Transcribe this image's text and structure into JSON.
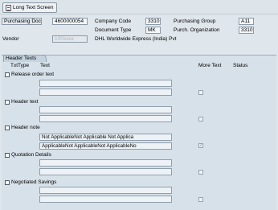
{
  "toolbar": {
    "long_text_label": "Long Text Screen"
  },
  "header": {
    "purchasing_doc_label": "Purchasing Doc.",
    "purchasing_doc_value": "4600000054",
    "company_code_label": "Company Code",
    "company_code_value": "3310",
    "purchasing_group_label": "Purchasing Group",
    "purchasing_group_value": "A11",
    "document_type_label": "Document Type",
    "document_type_value": "MK",
    "purch_org_label": "Purch. Organization",
    "purch_org_value": "3310",
    "vendor_label": "Vendor",
    "vendor_value": "100xxxx",
    "vendor_name": "DHL Worldwide Express (India) Pvt"
  },
  "panel": {
    "tab_label": "Header Texts",
    "col_txttype": "TxtType",
    "col_text": "Text",
    "col_more_text": "More Text",
    "col_status": "Status",
    "groups": [
      {
        "label": "Release order text",
        "lines": [
          "",
          ""
        ]
      },
      {
        "label": "Header text",
        "lines": [
          "",
          ""
        ]
      },
      {
        "label": "Header note",
        "lines": [
          "Not ApplicableNot Applicable Not Applica",
          "ApplicableNot ApplicableNot ApplicableNo"
        ]
      },
      {
        "label": "Quotation Details",
        "lines": [
          "",
          ""
        ]
      },
      {
        "label": "Negotiated Savings",
        "lines": [
          "",
          ""
        ]
      }
    ]
  }
}
